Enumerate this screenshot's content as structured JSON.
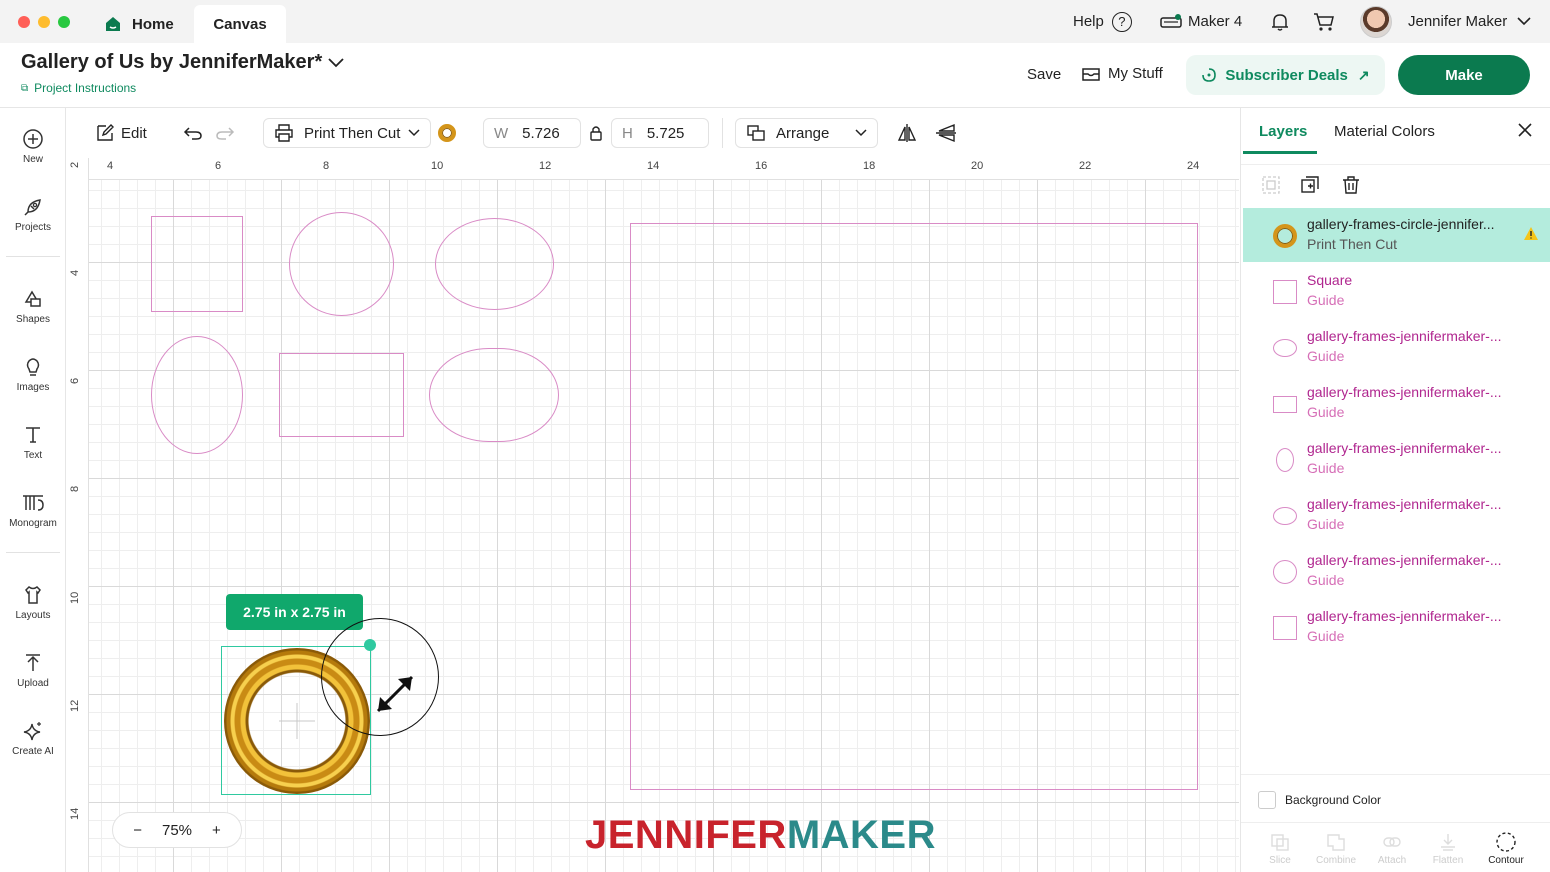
{
  "titlebar": {
    "tabs": {
      "home": "Home",
      "canvas": "Canvas"
    },
    "help": "Help",
    "machine": "Maker 4",
    "user_name": "Jennifer Maker"
  },
  "header": {
    "project_title": "Gallery of Us by JenniferMaker*",
    "project_instructions": "Project Instructions",
    "save": "Save",
    "my_stuff": "My Stuff",
    "subscriber_deals": "Subscriber Deals",
    "make": "Make"
  },
  "sidebar": {
    "items": [
      {
        "label": "New",
        "icon": "plus-circle-icon"
      },
      {
        "label": "Projects",
        "icon": "rocket-icon"
      },
      {
        "label": "Shapes",
        "icon": "shapes-icon"
      },
      {
        "label": "Images",
        "icon": "lightbulb-icon"
      },
      {
        "label": "Text",
        "icon": "text-icon"
      },
      {
        "label": "Monogram",
        "icon": "monogram-icon"
      },
      {
        "label": "Layouts",
        "icon": "shirt-icon"
      },
      {
        "label": "Upload",
        "icon": "upload-icon"
      },
      {
        "label": "Create AI",
        "icon": "sparkle-icon"
      }
    ]
  },
  "toolbar": {
    "edit": "Edit",
    "operation": "Print Then Cut",
    "width_label": "W",
    "width_value": "5.726",
    "height_label": "H",
    "height_value": "5.725",
    "arrange": "Arrange"
  },
  "canvas": {
    "ruler_top": [
      "4",
      "6",
      "8",
      "10",
      "12",
      "14",
      "16",
      "18",
      "20",
      "22",
      "24"
    ],
    "ruler_left": [
      "2",
      "4",
      "6",
      "8",
      "10",
      "12",
      "14"
    ],
    "dimension_badge": "2.75  in x 2.75  in",
    "zoom": "75%",
    "brand_part1": "JENNIFER",
    "brand_part2": "MAKER",
    "guide_color": "#d98bc6",
    "selection_color": "#2fc9a0"
  },
  "panel": {
    "tab_layers": "Layers",
    "tab_material": "Material Colors",
    "layers": [
      {
        "name": "gallery-frames-circle-jennifer...",
        "sub": "Print Then Cut",
        "thumb": "frame",
        "selected": true,
        "warning": true
      },
      {
        "name": "Square",
        "sub": "Guide",
        "thumb": "square"
      },
      {
        "name": "gallery-frames-jennifermaker-...",
        "sub": "Guide",
        "thumb": "ellipse-wide"
      },
      {
        "name": "gallery-frames-jennifermaker-...",
        "sub": "Guide",
        "thumb": "rect"
      },
      {
        "name": "gallery-frames-jennifermaker-...",
        "sub": "Guide",
        "thumb": "ellipse-tall"
      },
      {
        "name": "gallery-frames-jennifermaker-...",
        "sub": "Guide",
        "thumb": "ellipse-wide"
      },
      {
        "name": "gallery-frames-jennifermaker-...",
        "sub": "Guide",
        "thumb": "circle"
      },
      {
        "name": "gallery-frames-jennifermaker-...",
        "sub": "Guide",
        "thumb": "square"
      }
    ],
    "background_color": "Background Color",
    "bottom_actions": [
      {
        "label": "Slice",
        "enabled": false
      },
      {
        "label": "Combine",
        "enabled": false
      },
      {
        "label": "Attach",
        "enabled": false
      },
      {
        "label": "Flatten",
        "enabled": false
      },
      {
        "label": "Contour",
        "enabled": true
      }
    ]
  },
  "colors": {
    "accent": "#0b7a4f",
    "guide": "#d98bc6",
    "selected_layer": "#b4ecdd"
  }
}
